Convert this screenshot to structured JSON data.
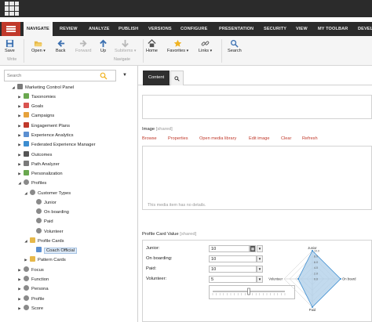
{
  "ribbon_tabs": [
    "NAVIGATE",
    "REVIEW",
    "ANALYZE",
    "PUBLISH",
    "VERSIONS",
    "CONFIGURE",
    "PRESENTATION",
    "SECURITY",
    "VIEW",
    "MY TOOLBAR",
    "DEVELO"
  ],
  "ribbon": {
    "save": "Save",
    "write_group": "Write",
    "open": "Open",
    "back": "Back",
    "forward": "Forward",
    "up": "Up",
    "subitems": "Subitems",
    "navigate_group": "Navigate",
    "home": "Home",
    "favorites": "Favorites",
    "links": "Links",
    "search": "Search"
  },
  "search": {
    "placeholder": "Search"
  },
  "tree": [
    {
      "label": "Marketing Control Panel",
      "expanded": true,
      "icon": "control-panel-icon"
    },
    {
      "label": "Taxonomies",
      "icon": "taxonomy-icon"
    },
    {
      "label": "Goals",
      "icon": "goal-icon"
    },
    {
      "label": "Campaigns",
      "icon": "campaign-icon"
    },
    {
      "label": "Engagement Plans",
      "icon": "engagement-plan-icon"
    },
    {
      "label": "Experience Analytics",
      "icon": "analytics-icon"
    },
    {
      "label": "Federated Experience Manager",
      "icon": "federated-icon"
    },
    {
      "label": "Outcomes",
      "icon": "outcome-icon"
    },
    {
      "label": "Path Analyzer",
      "icon": "path-analyzer-icon"
    },
    {
      "label": "Personalization",
      "icon": "personalization-icon"
    },
    {
      "label": "Profiles",
      "expanded": true,
      "icon": "gear-icon"
    },
    {
      "label": "Customer Types",
      "expanded": true,
      "icon": "gear-icon"
    },
    {
      "label": "Junior",
      "icon": "gear-icon"
    },
    {
      "label": "On boarding",
      "icon": "gear-icon"
    },
    {
      "label": "Paid",
      "icon": "gear-icon"
    },
    {
      "label": "Volunteer",
      "icon": "gear-icon"
    },
    {
      "label": "Profile Cards",
      "expanded": true,
      "icon": "folder-icon"
    },
    {
      "label": "Coach Official",
      "selected": true,
      "icon": "profile-card-icon"
    },
    {
      "label": "Pattern Cards",
      "icon": "folder-icon"
    },
    {
      "label": "Focus",
      "icon": "gear-icon"
    },
    {
      "label": "Function",
      "icon": "gear-icon"
    },
    {
      "label": "Persona",
      "icon": "gear-icon"
    },
    {
      "label": "Profile",
      "icon": "gear-icon"
    },
    {
      "label": "Score",
      "icon": "gear-icon"
    }
  ],
  "editor": {
    "content_tab": "Content",
    "image_field": {
      "label": "Image",
      "shared": "[shared]"
    },
    "image_actions": [
      "Browse",
      "Properties",
      "Open media library",
      "Edit image",
      "Clear",
      "Refresh"
    ],
    "media_note": "This media item has no details.",
    "profile_card_value": {
      "label": "Profile Card Value",
      "shared": "[shared]"
    },
    "profile_keys": [
      {
        "label": "Junior:",
        "value": "10"
      },
      {
        "label": "On boarding:",
        "value": "10"
      },
      {
        "label": "Paid:",
        "value": "10"
      },
      {
        "label": "Volunteer:",
        "value": "5"
      }
    ],
    "slider_value": 5,
    "slider_max": 10
  },
  "chart_data": {
    "type": "radar",
    "axes": [
      "Junior",
      "On board",
      "Paid",
      "Volunteer"
    ],
    "values": [
      10,
      10,
      10,
      5
    ],
    "ticks": [
      "10.0",
      "8.0",
      "6.0",
      "4.0",
      "2.0",
      "0.0"
    ],
    "range": [
      0,
      10
    ],
    "colors": {
      "fill": "#aecde8",
      "stroke": "#3c8dd0"
    }
  }
}
